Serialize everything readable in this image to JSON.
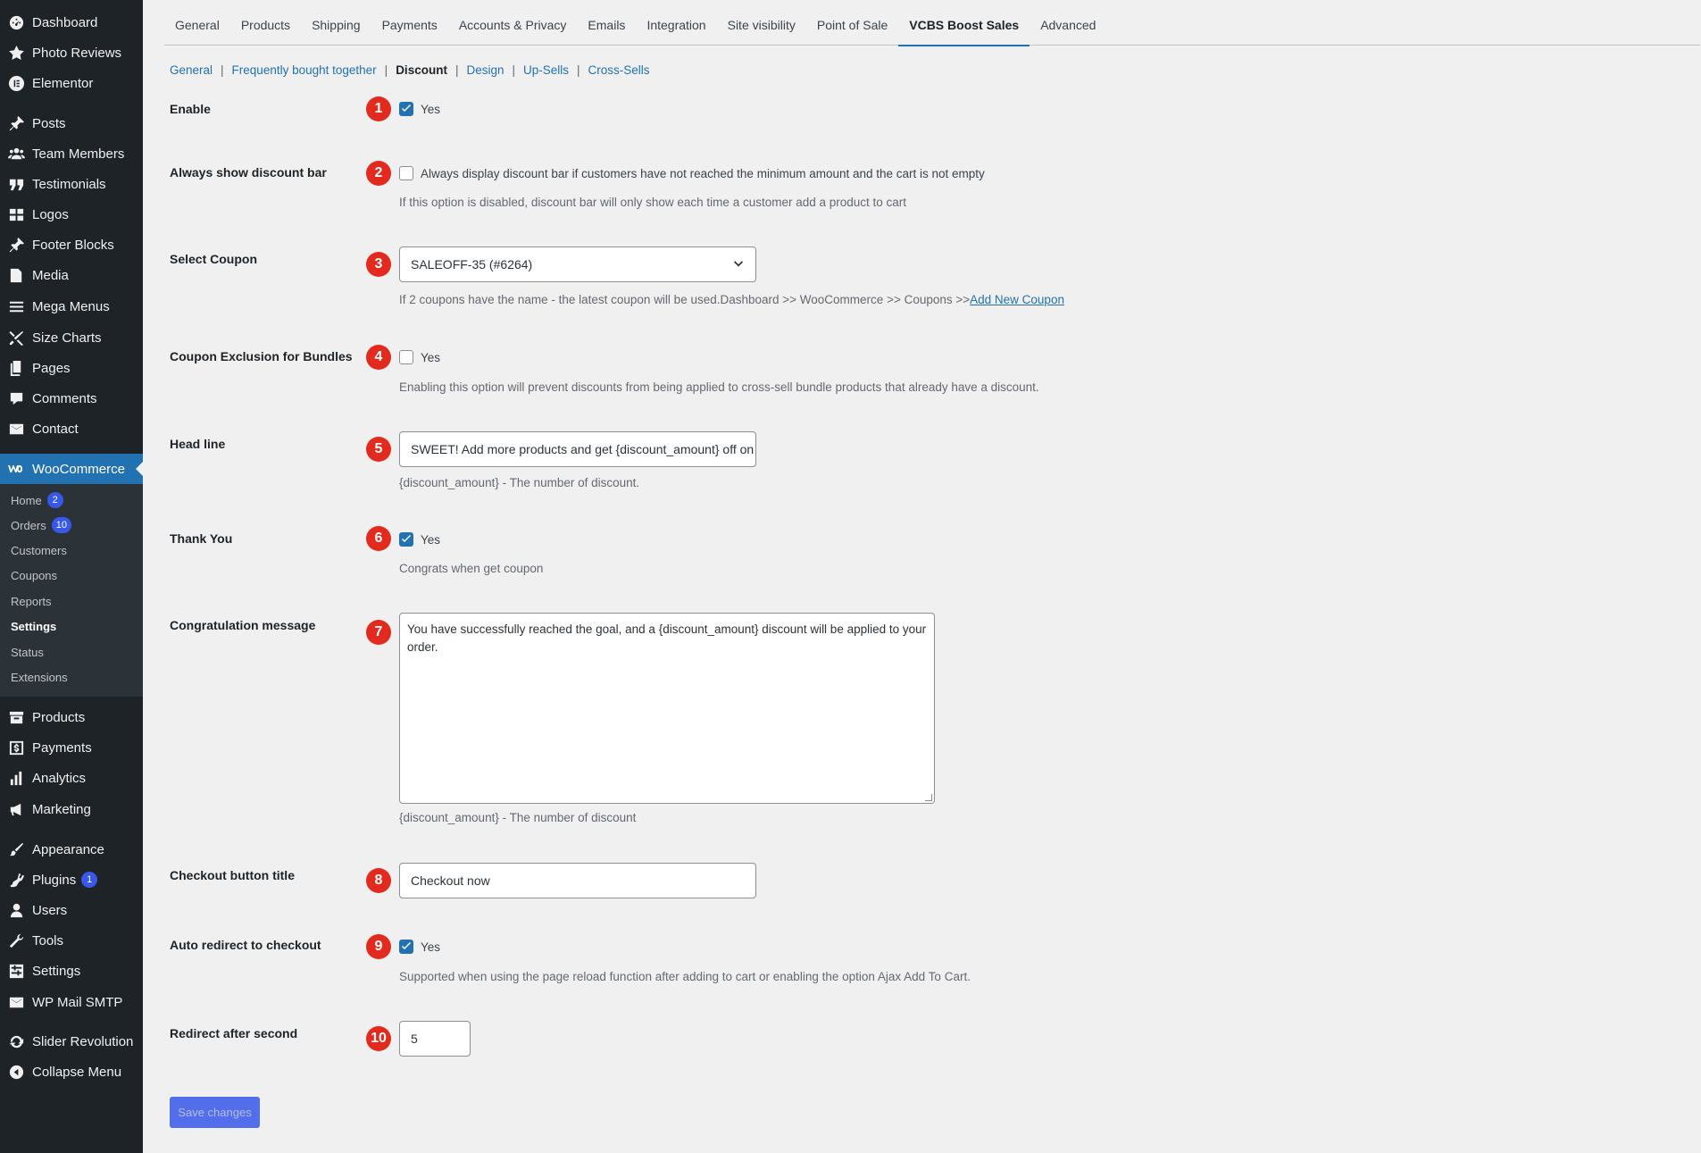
{
  "sidebar": {
    "items": [
      {
        "label": "Dashboard",
        "icon": "dashboard-icon"
      },
      {
        "label": "Photo Reviews",
        "icon": "star-icon"
      },
      {
        "label": "Elementor",
        "icon": "elementor-icon"
      },
      {
        "label": "Posts",
        "icon": "pin-icon"
      },
      {
        "label": "Team Members",
        "icon": "people-icon"
      },
      {
        "label": "Testimonials",
        "icon": "quote-icon"
      },
      {
        "label": "Logos",
        "icon": "grid-icon"
      },
      {
        "label": "Footer Blocks",
        "icon": "pin-icon"
      },
      {
        "label": "Media",
        "icon": "media-icon"
      },
      {
        "label": "Mega Menus",
        "icon": "menu-icon"
      },
      {
        "label": "Size Charts",
        "icon": "tools-icon"
      },
      {
        "label": "Pages",
        "icon": "pages-icon"
      },
      {
        "label": "Comments",
        "icon": "comment-icon"
      },
      {
        "label": "Contact",
        "icon": "mail-icon"
      }
    ],
    "woocommerce": {
      "label": "WooCommerce",
      "icon": "woo-icon"
    },
    "woo_sub": [
      {
        "label": "Home",
        "badge": "2"
      },
      {
        "label": "Orders",
        "badge": "10"
      },
      {
        "label": "Customers"
      },
      {
        "label": "Coupons"
      },
      {
        "label": "Reports"
      },
      {
        "label": "Settings"
      },
      {
        "label": "Status"
      },
      {
        "label": "Extensions"
      }
    ],
    "items2": [
      {
        "label": "Products",
        "icon": "archive-icon"
      },
      {
        "label": "Payments",
        "icon": "dollar-icon"
      },
      {
        "label": "Analytics",
        "icon": "bar-chart-icon"
      },
      {
        "label": "Marketing",
        "icon": "megaphone-icon"
      },
      {
        "label": "Appearance",
        "icon": "paintbrush-icon"
      },
      {
        "label": "Plugins",
        "icon": "plugin-icon",
        "badge": "1"
      },
      {
        "label": "Users",
        "icon": "user-icon"
      },
      {
        "label": "Tools",
        "icon": "wrench-icon"
      },
      {
        "label": "Settings",
        "icon": "settings-icon"
      },
      {
        "label": "WP Mail SMTP",
        "icon": "mail-icon"
      },
      {
        "label": "Slider Revolution",
        "icon": "refresh-icon"
      },
      {
        "label": "Collapse Menu",
        "icon": "collapse-icon"
      }
    ]
  },
  "tabs": [
    "General",
    "Products",
    "Shipping",
    "Payments",
    "Accounts & Privacy",
    "Emails",
    "Integration",
    "Site visibility",
    "Point of Sale",
    "VCBS Boost Sales",
    "Advanced"
  ],
  "subnav": [
    "General",
    "Frequently bought together",
    "Discount",
    "Design",
    "Up-Sells",
    "Cross-Sells"
  ],
  "rows": {
    "enable": {
      "label": "Enable",
      "num": "1",
      "cb_label": "Yes"
    },
    "always_show": {
      "label": "Always show discount bar",
      "num": "2",
      "cb_label": "Always display discount bar if customers have not reached the minimum amount and the cart is not empty",
      "desc": "If this option is disabled, discount bar will only show each time a customer add a product to cart"
    },
    "coupon": {
      "label": "Select Coupon",
      "num": "3",
      "value": "SALEOFF-35 (#6264)",
      "desc": "If 2 coupons have the name - the latest coupon will be used.Dashboard >> WooCommerce >> Coupons >>",
      "link": "Add New Coupon"
    },
    "exclusion": {
      "label": "Coupon Exclusion for Bundles",
      "num": "4",
      "cb_label": "Yes",
      "desc": "Enabling this option will prevent discounts from being applied to cross-sell bundle products that already have a discount."
    },
    "headline": {
      "label": "Head line",
      "num": "5",
      "value": "SWEET! Add more products and get {discount_amount} off on your order",
      "desc": "{discount_amount} - The number of discount."
    },
    "thankyou": {
      "label": "Thank You",
      "num": "6",
      "cb_label": "Yes",
      "desc": "Congrats when get coupon"
    },
    "congrat": {
      "label": "Congratulation message",
      "num": "7",
      "value": "You have successfully reached the goal, and a {discount_amount} discount will be applied to your order.",
      "desc": "{discount_amount} - The number of discount"
    },
    "checkout_title": {
      "label": "Checkout button title",
      "num": "8",
      "value": "Checkout now"
    },
    "auto_redirect": {
      "label": "Auto redirect to checkout",
      "num": "9",
      "cb_label": "Yes",
      "desc": "Supported when using the page reload function after adding to cart or enabling the option Ajax Add To Cart."
    },
    "redirect_after": {
      "label": "Redirect after second",
      "num": "10",
      "value": "5"
    }
  },
  "save_label": "Save changes"
}
